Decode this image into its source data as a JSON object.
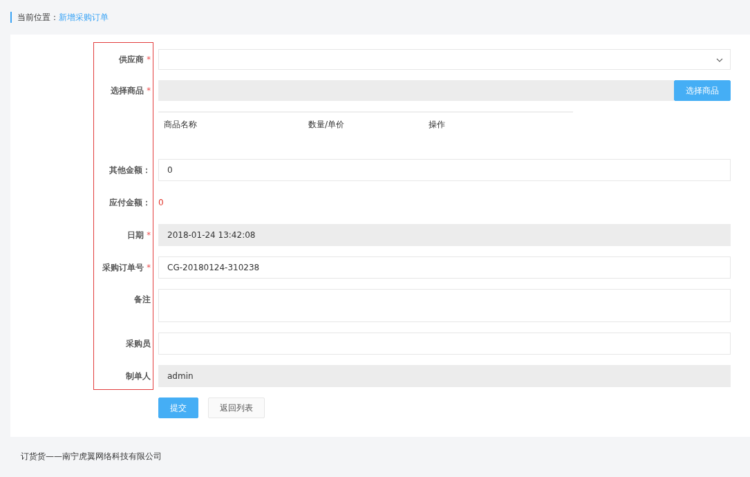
{
  "breadcrumb": {
    "label": "当前位置：",
    "current": "新增采购订单"
  },
  "fields": [
    {
      "kind": "select",
      "label": "供应商",
      "required_mark": "*"
    },
    {
      "kind": "picker",
      "label": "选择商品",
      "required_mark": "*",
      "button": "选择商品"
    },
    {
      "kind": "table",
      "columns": [
        "商品名称",
        "数量/单价",
        "操作"
      ]
    },
    {
      "kind": "input",
      "label": "其他金额：",
      "value": "0"
    },
    {
      "kind": "amount",
      "label": "应付金额：",
      "value": "0"
    },
    {
      "kind": "readonly",
      "label": "日期",
      "required_mark": "*",
      "value": "2018-01-24 13:42:08"
    },
    {
      "kind": "input",
      "label": "采购订单号",
      "required_mark": "*",
      "value": "CG-20180124-310238"
    },
    {
      "kind": "textarea",
      "label": "备注"
    },
    {
      "kind": "input",
      "label": "采购员"
    },
    {
      "kind": "readonly",
      "label": "制单人",
      "value": "admin"
    }
  ],
  "buttons": [
    {
      "label": "提交",
      "kind": "primary"
    },
    {
      "label": "返回列表",
      "kind": "default"
    }
  ],
  "footer": "订货货——南宁虎翼网络科技有限公司"
}
